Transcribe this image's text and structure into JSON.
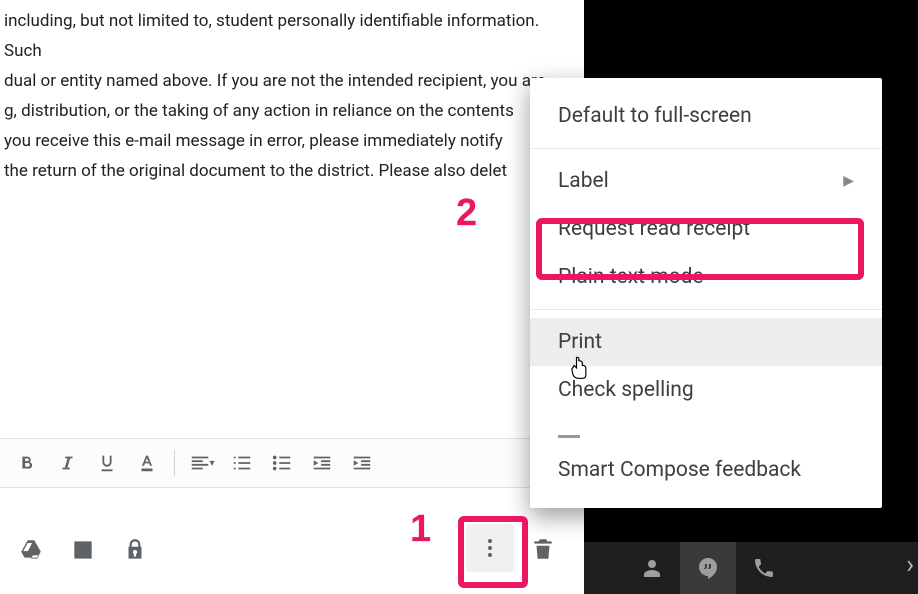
{
  "email_body_lines": [
    " including, but not limited to, student personally identifiable information. Such",
    "dual or entity named above. If you are not the intended recipient, you are",
    "g, distribution, or the taking of any action in reliance on the contents",
    "you receive this e-mail message in error, please immediately notify",
    " the return of the original document to the district. Please also delet"
  ],
  "menu": {
    "full_screen": "Default to full-screen",
    "label": "Label",
    "read_receipt": "Request read receipt",
    "plain_text": "Plain text mode",
    "print": "Print",
    "check_spelling": "Check spelling",
    "smart_compose": "Smart Compose feedback"
  },
  "annotations": {
    "step1": "1",
    "step2": "2"
  }
}
